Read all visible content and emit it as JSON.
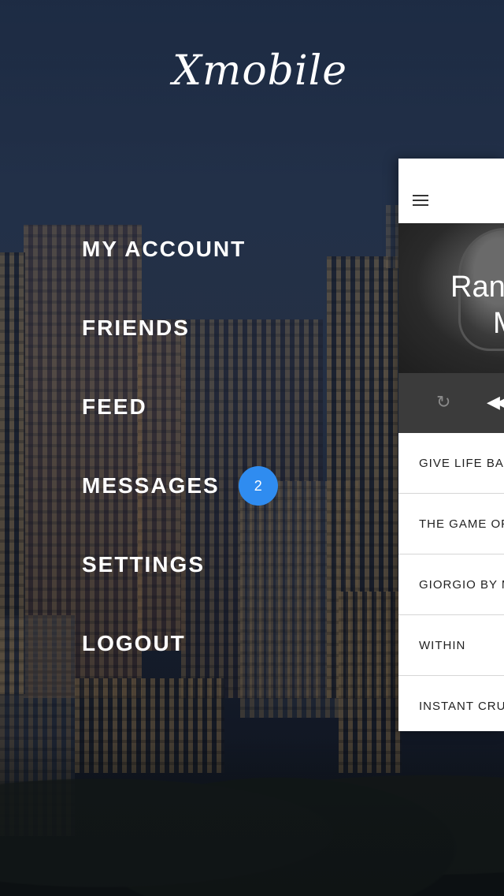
{
  "app": {
    "logo": "Xmobile"
  },
  "menu": {
    "items": [
      {
        "label": "MY ACCOUNT"
      },
      {
        "label": "FRIENDS"
      },
      {
        "label": "FEED"
      },
      {
        "label": "MESSAGES",
        "badge": "2"
      },
      {
        "label": "SETTINGS"
      },
      {
        "label": "LOGOUT"
      }
    ]
  },
  "panel": {
    "hero_title_line1": "Ran",
    "hero_title_line2": "M",
    "tracks": [
      {
        "title": "GIVE LIFE BAC"
      },
      {
        "title": "THE GAME OF"
      },
      {
        "title": "GIORGIO BY M"
      },
      {
        "title": "WITHIN"
      },
      {
        "title": "INSTANT CRU"
      }
    ]
  },
  "colors": {
    "badge": "#2f8cf0",
    "menu_text": "#ffffff",
    "panel_bg": "#ffffff",
    "player_bar": "#3b3b3b"
  },
  "icons": {
    "menu": "hamburger-icon",
    "repeat": "repeat-icon",
    "rewind": "rewind-icon"
  }
}
